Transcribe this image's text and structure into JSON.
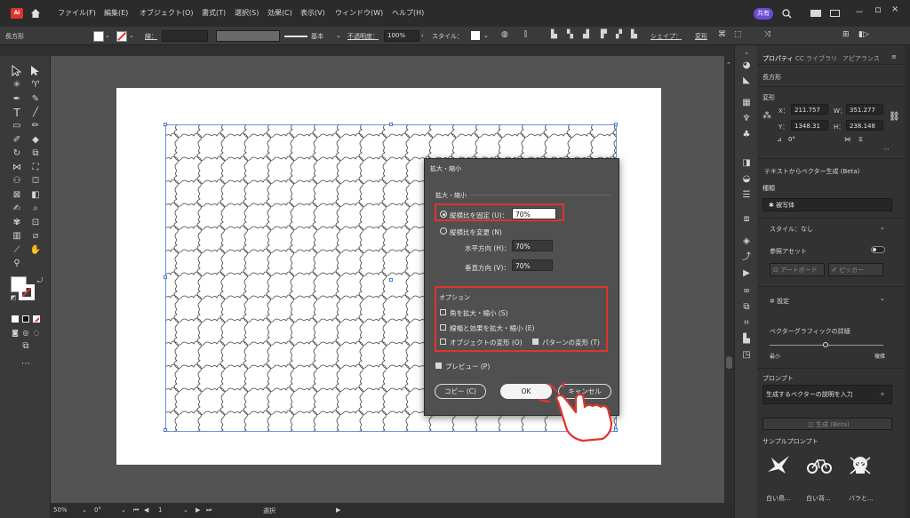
{
  "app": {
    "logo": "Ai",
    "home_icon": "home-icon"
  },
  "menubar": {
    "items": [
      "ファイル(F)",
      "編集(E)",
      "オブジェクト(O)",
      "書式(T)",
      "選択(S)",
      "効果(C)",
      "表示(V)",
      "ウィンドウ(W)",
      "ヘルプ(H)"
    ],
    "share": "共有",
    "window_controls": [
      "－",
      "ロ",
      "×"
    ]
  },
  "controlbar": {
    "selection": "長方形",
    "stroke_label": "線：",
    "stroke_style": "基本",
    "opacity_label": "不透明度：",
    "opacity_value": "100%",
    "style_label": "スタイル：",
    "shape_label": "シェイプ：",
    "transform_label": "変形"
  },
  "dialog": {
    "title": "拡大・縮小",
    "section_scale": "拡大・縮小",
    "uniform_label": "縦横比を固定 (U)：",
    "uniform_value": "70%",
    "nonuniform_label": "縦横比を変更 (N)",
    "horizontal_label": "水平方向 (H)：",
    "horizontal_value": "70%",
    "vertical_label": "垂直方向 (V)：",
    "vertical_value": "70%",
    "options_title": "オプション",
    "opt_corners": "角を拡大・縮小 (S)",
    "opt_strokes": "線幅と効果を拡大・縮小 (E)",
    "opt_objects": "オブジェクトの変形 (O)",
    "opt_patterns": "パターンの変形 (T)",
    "preview": "プレビュー (P)",
    "copy_button": "コピー (C)",
    "ok_button": "OK",
    "cancel_button": "キャンセル"
  },
  "rightpanel": {
    "tabs": [
      "プロパティ",
      "CC ライブラリ",
      "アピアランス"
    ],
    "selection_type": "長方形",
    "transform_title": "変形",
    "x_label": "X：",
    "x_value": "211.757",
    "w_label": "W：",
    "w_value": "351.277",
    "y_label": "Y：",
    "y_value": "1348.31",
    "h_label": "H：",
    "h_value": "238.148",
    "angle_value": "0°",
    "text_to_vector": "テキストからベクター生成 (Beta)",
    "type_label": "種類",
    "type_value": "被写体",
    "style_value": "スタイル：なし",
    "reference_asset": "参照アセット",
    "artboard_button": "アートボード",
    "pick_button": "ピッカー",
    "settings_label": "設定",
    "vector_detail": "ベクターグラフィックの詳細",
    "min_label": "最小",
    "max_label": "複雑",
    "prompt_title": "プロンプト",
    "prompt_placeholder": "生成するベクターの説明を入力",
    "generate_button": "生成 (Beta)",
    "sample_title": "サンプルプロンプト",
    "samples": [
      "白い鳥...",
      "白い背...",
      "バラと..."
    ]
  },
  "statusbar": {
    "zoom": "50%",
    "rotation": "0°",
    "artboard_num": "1",
    "mode": "選択"
  },
  "colors": {
    "accent_red": "#e0342b",
    "share_purple": "#6c4bd8"
  }
}
